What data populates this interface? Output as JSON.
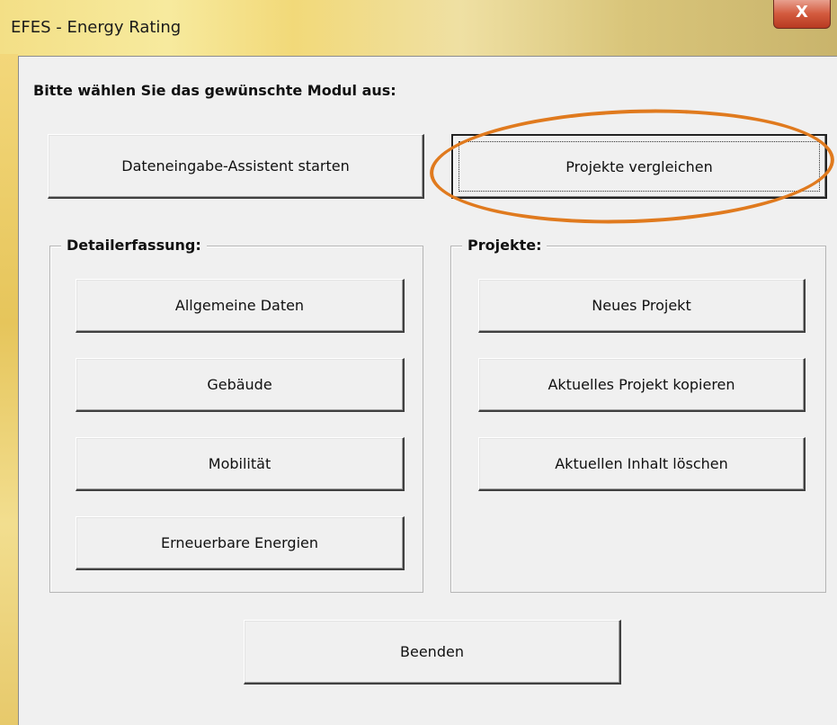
{
  "window": {
    "title": "EFES - Energy Rating",
    "close_label": "X"
  },
  "heading": "Bitte wählen Sie das gewünschte Modul aus:",
  "top_buttons": {
    "wizard": "Dateneingabe-Assistent starten",
    "compare": "Projekte vergleichen"
  },
  "detail_group": {
    "label": "Detailerfassung:",
    "buttons": [
      "Allgemeine Daten",
      "Gebäude",
      "Mobilität",
      "Erneuerbare Energien"
    ]
  },
  "projects_group": {
    "label": "Projekte:",
    "buttons": [
      "Neues Projekt",
      "Aktuelles Projekt kopieren",
      "Aktuellen Inhalt löschen"
    ]
  },
  "exit_button": "Beenden",
  "annotation": {
    "highlight_color": "#e07a1e"
  }
}
